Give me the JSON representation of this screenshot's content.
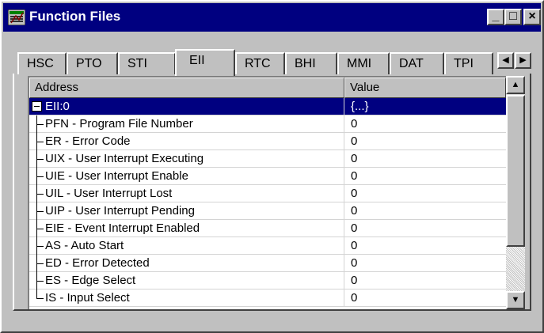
{
  "window": {
    "title": "Function Files",
    "controls": {
      "minimize": "_",
      "maximize": "□",
      "close": "×"
    }
  },
  "tabs": [
    {
      "label": "HSC",
      "active": false
    },
    {
      "label": "PTO",
      "active": false
    },
    {
      "label": "STI",
      "active": false
    },
    {
      "label": "EII",
      "active": true
    },
    {
      "label": "RTC",
      "active": false
    },
    {
      "label": "BHI",
      "active": false
    },
    {
      "label": "MMI",
      "active": false
    },
    {
      "label": "DAT",
      "active": false
    },
    {
      "label": "TPI",
      "active": false
    }
  ],
  "tab_scroll": {
    "left": "◀",
    "right": "▶"
  },
  "grid": {
    "columns": {
      "address": "Address",
      "value": "Value"
    },
    "rows": [
      {
        "address": "EII:0",
        "value": "{...}",
        "selected": true,
        "expander": "minus"
      },
      {
        "address": "PFN - Program File Number",
        "value": "0"
      },
      {
        "address": "ER - Error Code",
        "value": "0"
      },
      {
        "address": "UIX - User Interrupt Executing",
        "value": "0"
      },
      {
        "address": "UIE - User Interrupt Enable",
        "value": "0"
      },
      {
        "address": "UIL - User Interrupt Lost",
        "value": "0"
      },
      {
        "address": "UIP - User Interrupt Pending",
        "value": "0"
      },
      {
        "address": "EIE - Event Interrupt Enabled",
        "value": "0"
      },
      {
        "address": "AS - Auto Start",
        "value": "0"
      },
      {
        "address": "ED - Error Detected",
        "value": "0"
      },
      {
        "address": "ES - Edge Select",
        "value": "0"
      },
      {
        "address": "IS - Input Select",
        "value": "0"
      }
    ]
  },
  "scrollbar": {
    "up": "▲",
    "down": "▼"
  },
  "colors": {
    "selection": "#000080",
    "face": "#c0c0c0",
    "titlebar": "#000080"
  }
}
